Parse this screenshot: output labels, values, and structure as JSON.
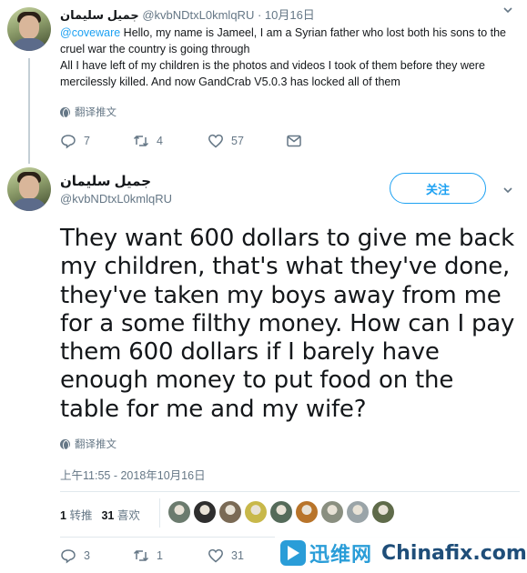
{
  "tweet1": {
    "author_name": "جميل سليمان",
    "handle_date": "@kvbNDtxL0kmlqRU · 10月16日",
    "mention": "@coveware",
    "line1": " Hello, my name is Jameel, I am a Syrian father who lost both his sons to the cruel war the country is going through",
    "line2": "All I have left of my children is the photos and videos I took of them before they were mercilessly killed. And now GandCrab V5.0.3 has locked all of them",
    "translate": "翻译推文",
    "replies": "7",
    "retweets": "4",
    "likes": "57"
  },
  "tweet2": {
    "author_name": "جميل سليمان",
    "handle": "@kvbNDtxL0kmlqRU",
    "follow_label": "关注",
    "body": "They want 600 dollars to give me back my children, that's what they've done, they've taken my boys away from me for a some filthy money. How can I pay them 600 dollars if I barely have enough money to put food on the table for me and my wife?",
    "translate": "翻译推文",
    "timestamp": "上午11:55 - 2018年10月16日",
    "retweet_count": "1",
    "retweet_label": "转推",
    "like_count": "31",
    "like_label": "喜欢",
    "replies": "3",
    "retweets": "1",
    "likes": "31",
    "liker_colors": [
      "#6b7b6e",
      "#2e2e2e",
      "#7a6a55",
      "#c8b84a",
      "#556b5a",
      "#b8742a",
      "#8a8f80",
      "#9aa4a8",
      "#5f6b4a"
    ]
  },
  "watermark": {
    "cn": "迅维网",
    "en": "Chinafix.com"
  },
  "colors": {
    "accent": "#1da1f2",
    "muted": "#657786",
    "text": "#14171a"
  }
}
